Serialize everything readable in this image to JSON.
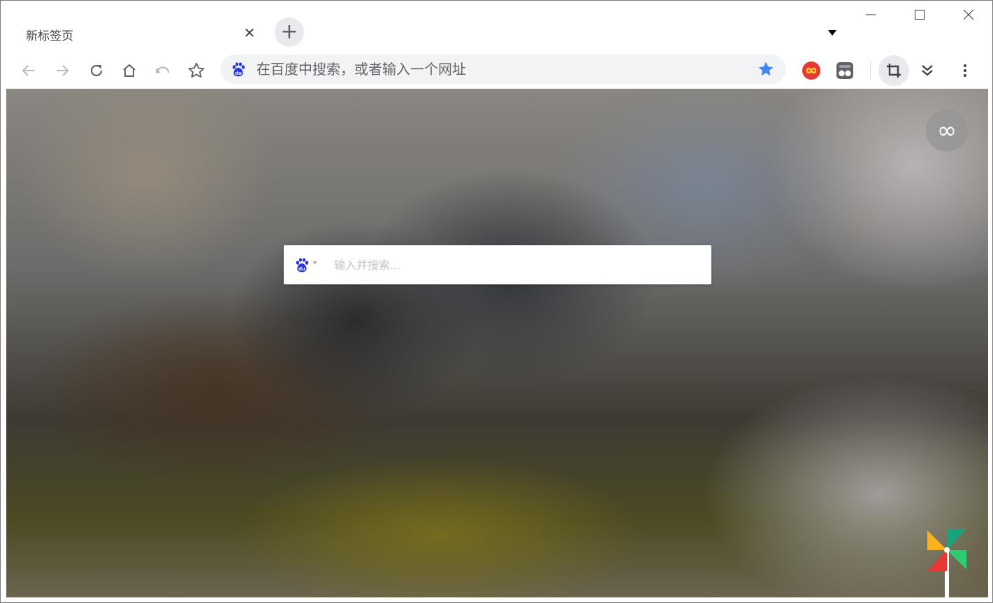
{
  "tab": {
    "title": "新标签页",
    "close_label": "✕",
    "new_tab_label": "+"
  },
  "omnibox": {
    "placeholder": "在百度中搜索，或者输入一个网址",
    "value": ""
  },
  "search": {
    "placeholder": "输入并搜索...",
    "value": "",
    "dropdown_caret": "▾"
  },
  "content": {
    "infinity_label": "∞"
  },
  "icons": {
    "back": "back-arrow-icon",
    "forward": "forward-arrow-icon",
    "reload": "reload-icon",
    "home": "home-icon",
    "undo": "undo-icon",
    "bookmark": "star-outline-icon",
    "bookmarked": "star-filled-icon",
    "extension_infinity": "infinity-extension-icon",
    "extension_tampermonkey": "tampermonkey-icon",
    "crop": "crop-icon",
    "more_extensions": "double-chevron-down-icon",
    "menu": "vertical-dots-icon",
    "search_engine": "baidu-paw-icon",
    "pinwheel": "pinwheel-icon"
  },
  "colors": {
    "accent_blue": "#4285f4",
    "baidu_blue": "#2932e1",
    "toolbar_icon": "#5f6368"
  }
}
